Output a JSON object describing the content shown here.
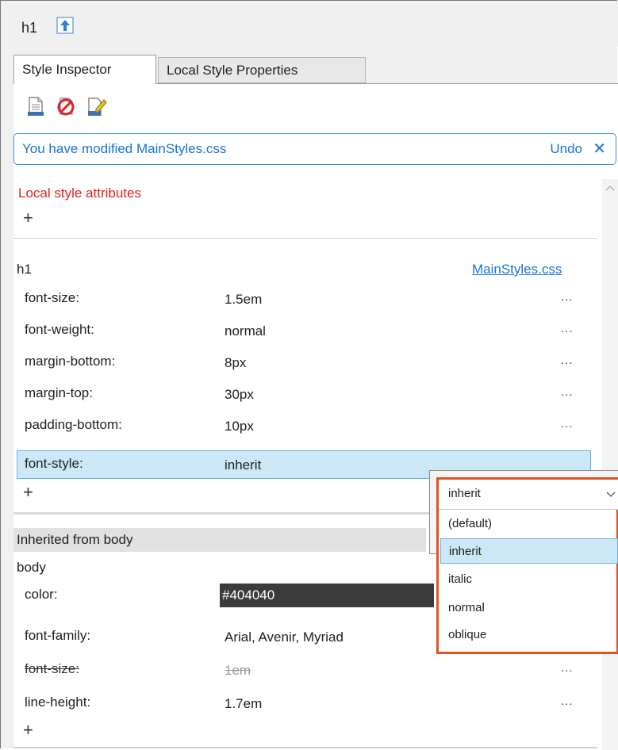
{
  "window": {
    "title": "h1"
  },
  "tabs": [
    {
      "label": "Style Inspector",
      "active": true
    },
    {
      "label": "Local Style Properties",
      "active": false
    }
  ],
  "toolbar": {
    "icons": [
      "new-style-icon",
      "clear-style-icon",
      "edit-style-icon"
    ]
  },
  "infobar": {
    "message": "You have modified  MainStyles.css",
    "undo": "Undo",
    "close": "✕"
  },
  "local": {
    "heading": "Local style attributes",
    "add": "+"
  },
  "rule": {
    "selector": "h1",
    "source": "MainStyles.css",
    "properties": [
      {
        "name": "font-size:",
        "value": "1.5em",
        "more": "..."
      },
      {
        "name": "font-weight:",
        "value": "normal",
        "more": "..."
      },
      {
        "name": "margin-bottom:",
        "value": "8px",
        "more": "..."
      },
      {
        "name": "margin-top:",
        "value": "30px",
        "more": "..."
      },
      {
        "name": "padding-bottom:",
        "value": "10px",
        "more": "..."
      },
      {
        "name": "font-style:",
        "value": "inherit"
      }
    ],
    "add": "+"
  },
  "inherited": {
    "header": "Inherited from body",
    "selector": "body",
    "properties": [
      {
        "name": "color:",
        "value": "#404040"
      },
      {
        "name": "font-family:",
        "value": "Arial, Avenir, Myriad"
      },
      {
        "name": "font-size:",
        "value": "1em",
        "more": "...",
        "overridden": true
      },
      {
        "name": "line-height:",
        "value": "1.7em",
        "more": "..."
      }
    ],
    "add": "+"
  },
  "dropdown": {
    "selected": "inherit",
    "options": [
      "(default)",
      "inherit",
      "italic",
      "normal",
      "oblique"
    ],
    "highlighted_index": 1,
    "border_color": "#e05424"
  },
  "colors": {
    "accent": "#1a73d1",
    "local_heading": "#e51d1d",
    "selection": "#cce8f6"
  }
}
